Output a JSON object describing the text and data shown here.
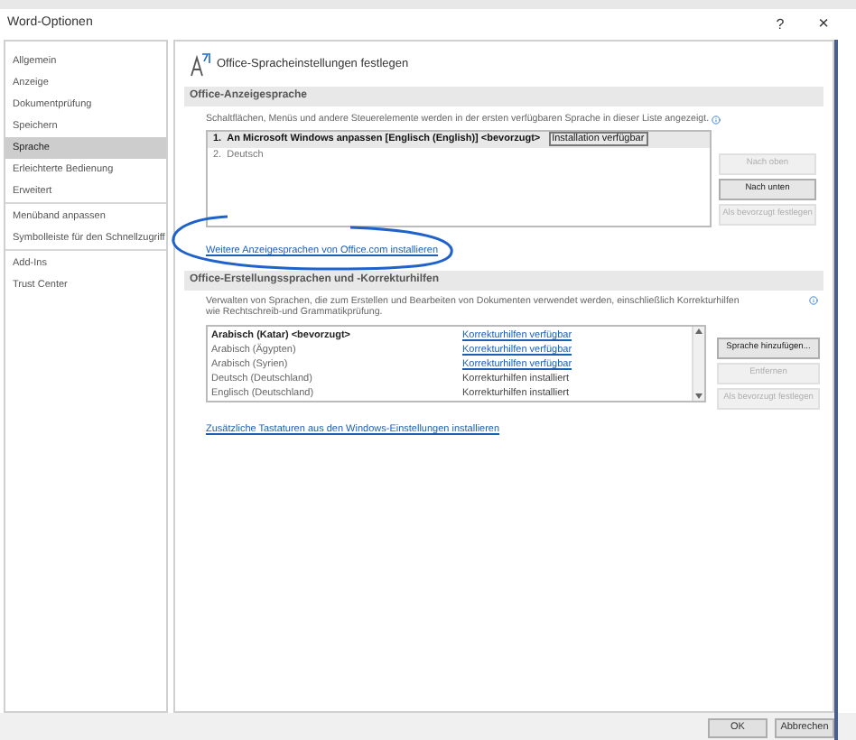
{
  "window": {
    "title": "Word-Optionen",
    "help": "?",
    "close": "×"
  },
  "sidebar": {
    "groups": [
      [
        {
          "label": "Allgemein",
          "selected": false
        },
        {
          "label": "Anzeige",
          "selected": false
        },
        {
          "label": "Dokumentprüfung",
          "selected": false
        },
        {
          "label": "Speichern",
          "selected": false
        },
        {
          "label": "Sprache",
          "selected": true
        },
        {
          "label": "Erleichterte Bedienung",
          "selected": false
        },
        {
          "label": "Erweitert",
          "selected": false
        }
      ],
      [
        {
          "label": "Menüband anpassen",
          "selected": false
        },
        {
          "label": "Symbolleiste für den Schnellzugriff",
          "selected": false
        }
      ],
      [
        {
          "label": "Add-Ins",
          "selected": false
        },
        {
          "label": "Trust Center",
          "selected": false
        }
      ]
    ]
  },
  "header": "Office-Spracheinstellungen festlegen",
  "display_language": {
    "title": "Office-Anzeigesprache",
    "description": "Schaltflächen, Menüs und andere Steuerelemente werden in der ersten verfügbaren Sprache in dieser Liste angezeigt.",
    "languages": [
      {
        "number": "1.",
        "name": "An Microsoft Windows anpassen [Englisch (English)] <bevorzugt>",
        "status": "Installation verfügbar",
        "selected": true
      },
      {
        "number": "2.",
        "name": "Deutsch",
        "selected": false
      }
    ],
    "buttons": [
      {
        "label": "Nach oben",
        "disabled": true
      },
      {
        "label": "Nach unten",
        "disabled": false
      },
      {
        "label": "Als bevorzugt festlegen",
        "disabled": true
      }
    ],
    "link": "Weitere Anzeigesprachen von Office.com installieren"
  },
  "authoring": {
    "title": "Office-Erstellungssprachen und -Korrekturhilfen",
    "description": "Verwalten von Sprachen, die zum Erstellen und Bearbeiten von Dokumenten verwendet werden, einschließlich Korrekturhilfen wie Rechtschreib-und Grammatikprüfung.",
    "rows": [
      {
        "language": "Arabisch (Katar) <bevorzugt>",
        "status": "Korrekturhilfen verfügbar",
        "kind": "link",
        "preferred": true
      },
      {
        "language": "Arabisch (Ägypten)",
        "status": "Korrekturhilfen verfügbar",
        "kind": "link",
        "preferred": false
      },
      {
        "language": "Arabisch (Syrien)",
        "status": "Korrekturhilfen verfügbar",
        "kind": "link",
        "preferred": false
      },
      {
        "language": "Deutsch (Deutschland)",
        "status": "Korrekturhilfen installiert",
        "kind": "text",
        "preferred": false
      },
      {
        "language": "Englisch (Deutschland)",
        "status": "Korrekturhilfen installiert",
        "kind": "text",
        "preferred": false
      }
    ],
    "buttons": [
      {
        "label": "Sprache hinzufügen...",
        "disabled": false
      },
      {
        "label": "Entfernen",
        "disabled": true
      },
      {
        "label": "Als bevorzugt festlegen",
        "disabled": true
      }
    ],
    "link": "Zusätzliche Tastaturen aus den Windows-Einstellungen installieren"
  },
  "footer": {
    "buttons": [
      "OK",
      "Abbrechen"
    ]
  }
}
